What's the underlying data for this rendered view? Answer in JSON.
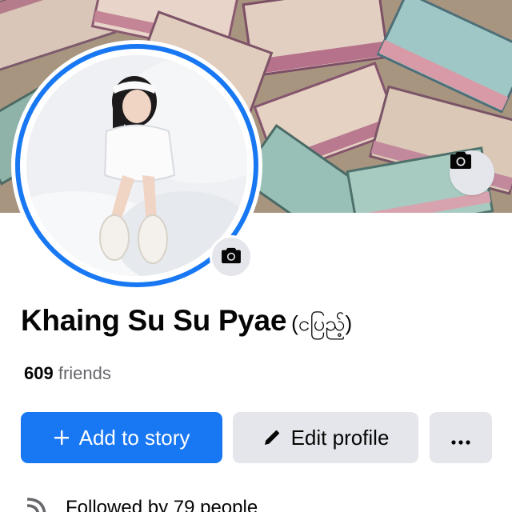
{
  "profile": {
    "name": "Khaing Su Su Pyae",
    "nickname": "(ငပြည့်)",
    "friends_count": "609",
    "friends_label": "friends"
  },
  "actions": {
    "add_story_label": "Add to story",
    "edit_profile_label": "Edit profile",
    "more_label": "•••"
  },
  "followed": {
    "text": "Followed by 79 people"
  },
  "icons": {
    "cover_camera": "camera-icon",
    "avatar_camera": "camera-icon",
    "add_story": "plus-icon",
    "edit_profile": "pencil-icon",
    "more": "more-horizontal-icon",
    "followed": "rss-feed-icon"
  },
  "colors": {
    "primary": "#1877f2",
    "secondary_button": "#e4e6eb",
    "text_primary": "#050505",
    "text_secondary": "#65676b"
  }
}
